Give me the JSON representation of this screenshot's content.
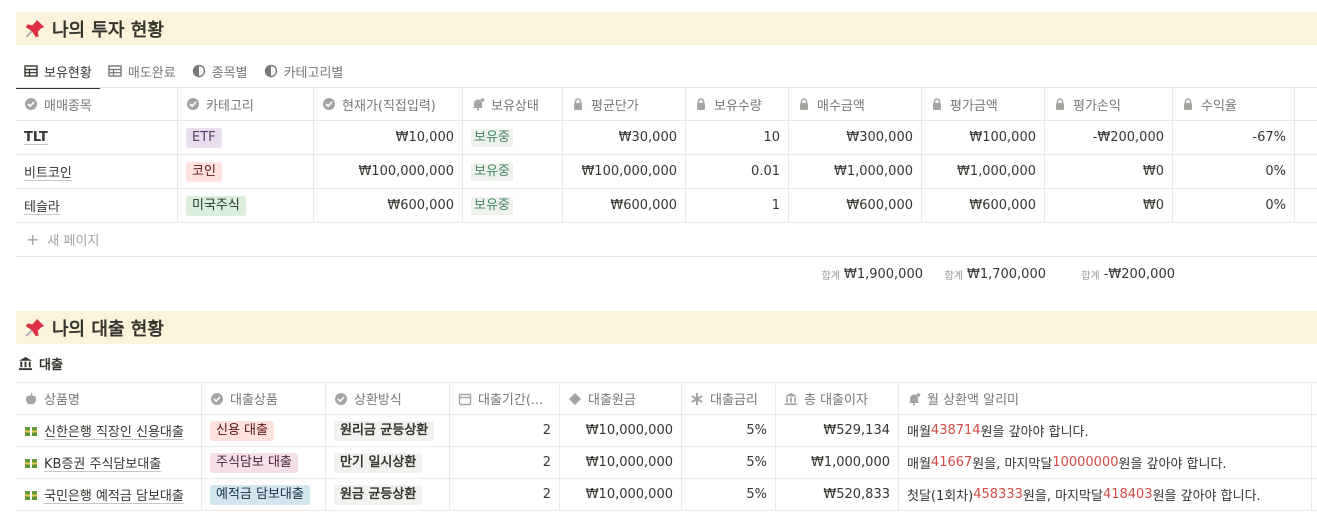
{
  "section1": {
    "title": "나의 투자 현황",
    "views": [
      {
        "label": "보유현황",
        "icon": "table-icon"
      },
      {
        "label": "매도완료",
        "icon": "table-icon"
      },
      {
        "label": "종목별",
        "icon": "chart-icon"
      },
      {
        "label": "카테고리별",
        "icon": "chart-icon"
      }
    ],
    "columns": [
      "매매종목",
      "카테고리",
      "현재가(직접입력)",
      "보유상태",
      "평균단가",
      "보유수량",
      "매수금액",
      "평가금액",
      "평가손익",
      "수익율"
    ],
    "rows": [
      {
        "name": "TLT",
        "category": "ETF",
        "price": "₩10,000",
        "status": "보유중",
        "avg": "₩30,000",
        "qty": "10",
        "buy": "₩300,000",
        "eval": "₩100,000",
        "pl": "-₩200,000",
        "rate": "-67%"
      },
      {
        "name": "비트코인",
        "category": "코인",
        "price": "₩100,000,000",
        "status": "보유중",
        "avg": "₩100,000,000",
        "qty": "0.01",
        "buy": "₩1,000,000",
        "eval": "₩1,000,000",
        "pl": "₩0",
        "rate": "0%"
      },
      {
        "name": "테슬라",
        "category": "미국주식",
        "price": "₩600,000",
        "status": "보유중",
        "avg": "₩600,000",
        "qty": "1",
        "buy": "₩600,000",
        "eval": "₩600,000",
        "pl": "₩0",
        "rate": "0%"
      }
    ],
    "new_page": "새 페이지",
    "sum_label": "합계",
    "sums": {
      "buy": "₩1,900,000",
      "eval": "₩1,700,000",
      "pl": "-₩200,000"
    },
    "colors": {
      "etf": "#e8deee",
      "coin": "#ffe2dd",
      "us": "#dbeddb",
      "status_text": "#448361"
    }
  },
  "section2": {
    "title": "나의 대출 현황",
    "db_title": "대출",
    "columns": [
      "상품명",
      "대출상품",
      "상환방식",
      "대출기간(...",
      "대출원금",
      "대출금리",
      "총 대출이자",
      "월 상환액 알리미"
    ],
    "rows": [
      {
        "name": "신한은행 직장인 신용대출",
        "product": "신용 대출",
        "method": "원리금 균등상환",
        "period": "2",
        "principal": "₩10,000,000",
        "rate": "5%",
        "interest": "₩529,134",
        "alert": [
          {
            "t": "매월 "
          },
          {
            "t": "438714",
            "h": true
          },
          {
            "t": "원을 갚아야 합니다."
          }
        ]
      },
      {
        "name": "KB증권 주식담보대출",
        "product": "주식담보 대출",
        "method": "만기 일시상환",
        "period": "2",
        "principal": "₩10,000,000",
        "rate": "5%",
        "interest": "₩1,000,000",
        "alert": [
          {
            "t": "매월 "
          },
          {
            "t": "41667",
            "h": true
          },
          {
            "t": "원을, 마지막달 "
          },
          {
            "t": "10000000",
            "h": true
          },
          {
            "t": "원을 갚아야 합니다."
          }
        ]
      },
      {
        "name": "국민은행 예적금 담보대출",
        "product": "예적금 담보대출",
        "method": "원금 균등상환",
        "period": "2",
        "principal": "₩10,000,000",
        "rate": "5%",
        "interest": "₩520,833",
        "alert": [
          {
            "t": "첫달(1회차) "
          },
          {
            "t": "458333",
            "h": true
          },
          {
            "t": "원을, 마지막달 "
          },
          {
            "t": "418403",
            "h": true
          },
          {
            "t": "원을 갚아야 합니다."
          }
        ]
      }
    ],
    "colors": {
      "credit": "#ffe2dd",
      "stock": "#f5e0e9",
      "deposit": "#d3e5ef",
      "highlight": "#d44c47"
    }
  }
}
